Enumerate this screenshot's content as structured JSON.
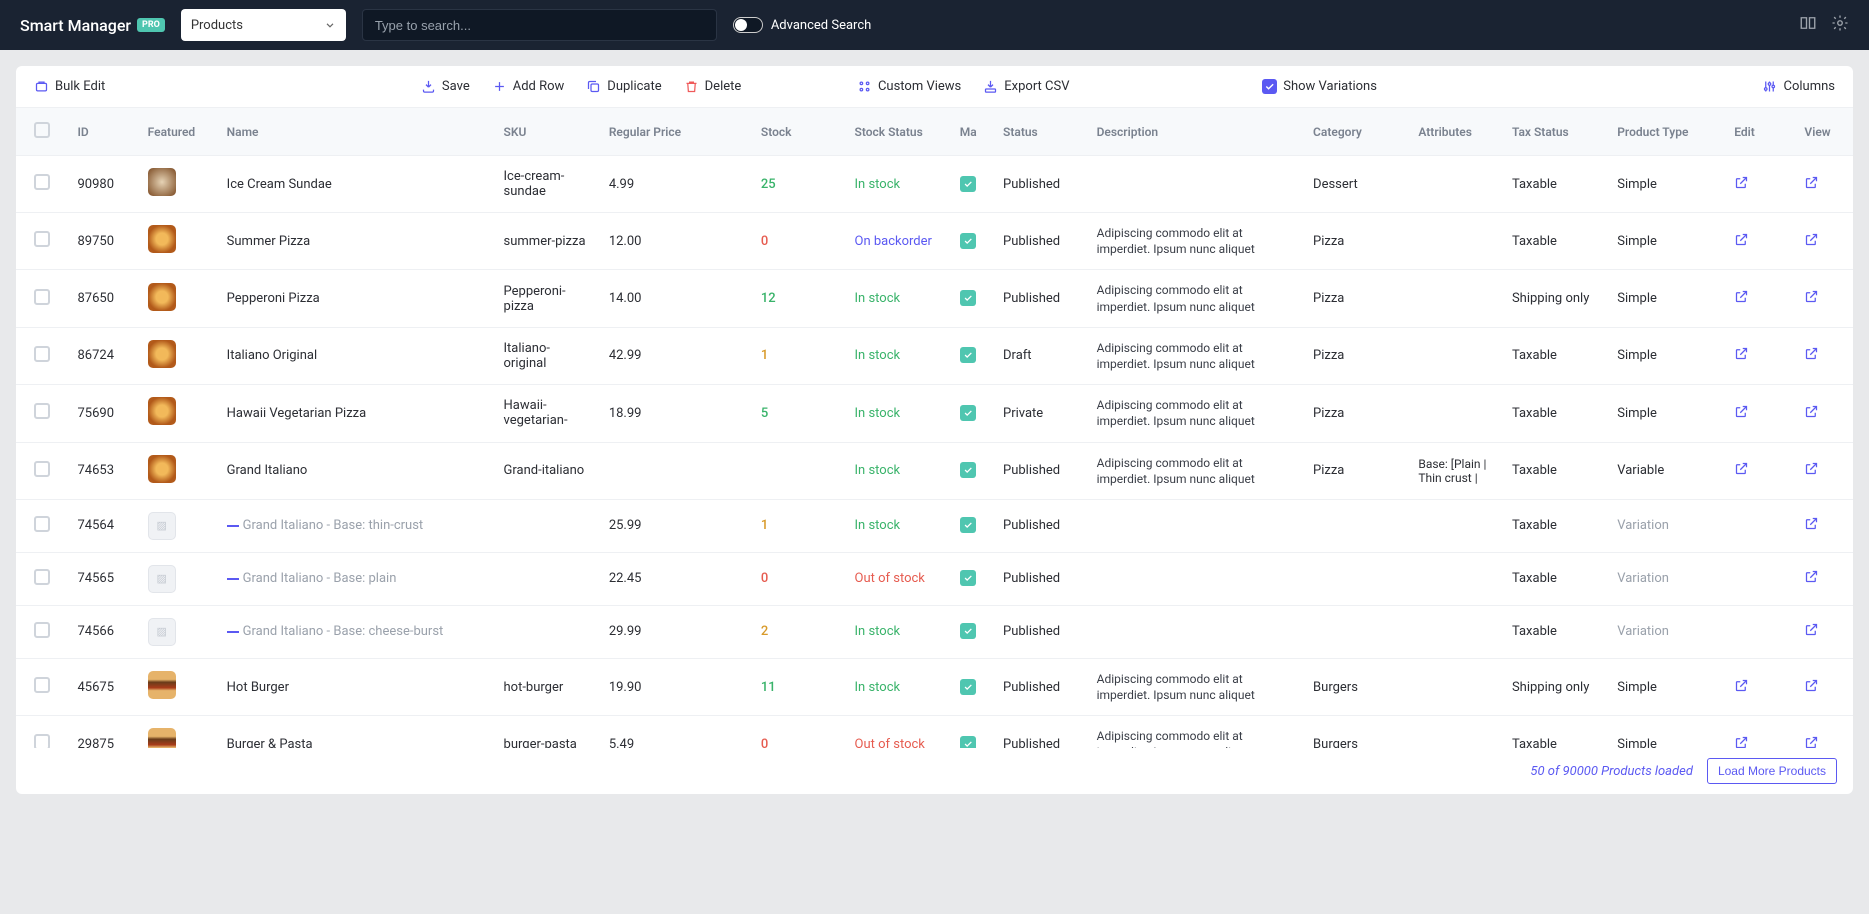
{
  "brand": {
    "name": "Smart Manager",
    "badge": "PRO"
  },
  "post_type_select": "Products",
  "search": {
    "placeholder": "Type to search..."
  },
  "advanced_search_label": "Advanced Search",
  "toolbar": {
    "bulk_edit": "Bulk Edit",
    "save": "Save",
    "add_row": "Add Row",
    "duplicate": "Duplicate",
    "delete": "Delete",
    "custom_views": "Custom Views",
    "export_csv": "Export CSV",
    "show_variations": "Show Variations",
    "columns": "Columns"
  },
  "columns": [
    "",
    "ID",
    "Featured",
    "Name",
    "SKU",
    "Regular Price",
    "Stock",
    "Stock Status",
    "Ma",
    "Status",
    "Description",
    "Category",
    "Attributes",
    "Tax Status",
    "Product Type",
    "Edit",
    "View"
  ],
  "rows": [
    {
      "id": "90980",
      "thumb": "dessert",
      "name": "Ice Cream Sundae",
      "sku": "Ice-cream-sundae",
      "price": "4.99",
      "stock": "25",
      "stock_cls": "green",
      "stock_status": "In stock",
      "ss_cls": "green",
      "status": "Published",
      "desc": "",
      "cat": "Dessert",
      "attr": "",
      "tax": "Taxable",
      "ptype": "Simple",
      "ptype_muted": false,
      "edit": true
    },
    {
      "id": "89750",
      "thumb": "pizza",
      "name": "Summer Pizza",
      "sku": "summer-pizza",
      "price": "12.00",
      "stock": "0",
      "stock_cls": "red",
      "stock_status": "On backorder",
      "ss_cls": "blue",
      "status": "Published",
      "desc": "Adipiscing commodo elit at imperdiet. Ipsum nunc aliquet",
      "cat": "Pizza",
      "attr": "",
      "tax": "Taxable",
      "ptype": "Simple",
      "ptype_muted": false,
      "edit": true
    },
    {
      "id": "87650",
      "thumb": "pizza",
      "name": "Pepperoni Pizza",
      "sku": "Pepperoni-pizza",
      "price": "14.00",
      "stock": "12",
      "stock_cls": "green",
      "stock_status": "In stock",
      "ss_cls": "green",
      "status": "Published",
      "desc": "Adipiscing commodo elit at imperdiet. Ipsum nunc aliquet",
      "cat": "Pizza",
      "attr": "",
      "tax": "Shipping only",
      "ptype": "Simple",
      "ptype_muted": false,
      "edit": true
    },
    {
      "id": "86724",
      "thumb": "pizza",
      "name": "Italiano Original",
      "sku": "Italiano-original",
      "price": "42.99",
      "stock": "1",
      "stock_cls": "orange",
      "stock_status": "In stock",
      "ss_cls": "green",
      "status": "Draft",
      "desc": "Adipiscing commodo elit at imperdiet. Ipsum nunc aliquet",
      "cat": "Pizza",
      "attr": "",
      "tax": "Taxable",
      "ptype": "Simple",
      "ptype_muted": false,
      "edit": true
    },
    {
      "id": "75690",
      "thumb": "pizza",
      "name": "Hawaii Vegetarian Pizza",
      "sku": "Hawaii-vegetarian-",
      "price": "18.99",
      "stock": "5",
      "stock_cls": "green",
      "stock_status": "In stock",
      "ss_cls": "green",
      "status": "Private",
      "desc": "Adipiscing commodo elit at imperdiet. Ipsum nunc aliquet",
      "cat": "Pizza",
      "attr": "",
      "tax": "Taxable",
      "ptype": "Simple",
      "ptype_muted": false,
      "edit": true
    },
    {
      "id": "74653",
      "thumb": "pizza",
      "name": "Grand Italiano",
      "sku": "Grand-italiano",
      "price": "",
      "stock": "",
      "stock_cls": "",
      "stock_status": "In stock",
      "ss_cls": "green",
      "status": "Published",
      "desc": "Adipiscing commodo elit at imperdiet. Ipsum nunc aliquet",
      "cat": "Pizza",
      "attr": "Base: [Plain | Thin crust |",
      "tax": "Taxable",
      "ptype": "Variable",
      "ptype_muted": false,
      "edit": true
    },
    {
      "id": "74564",
      "thumb": "placeholder",
      "variation": true,
      "name": "Grand Italiano - Base: thin-crust",
      "sku": "",
      "price": "25.99",
      "stock": "1",
      "stock_cls": "orange",
      "stock_status": "In stock",
      "ss_cls": "green",
      "status": "Published",
      "desc": "",
      "cat": "",
      "attr": "",
      "tax": "Taxable",
      "ptype": "Variation",
      "ptype_muted": true,
      "edit": false
    },
    {
      "id": "74565",
      "thumb": "placeholder",
      "variation": true,
      "name": "Grand Italiano - Base: plain",
      "sku": "",
      "price": "22.45",
      "stock": "0",
      "stock_cls": "red",
      "stock_status": "Out of stock",
      "ss_cls": "red",
      "status": "Published",
      "desc": "",
      "cat": "",
      "attr": "",
      "tax": "Taxable",
      "ptype": "Variation",
      "ptype_muted": true,
      "edit": false
    },
    {
      "id": "74566",
      "thumb": "placeholder",
      "variation": true,
      "name": "Grand Italiano - Base: cheese-burst",
      "sku": "",
      "price": "29.99",
      "stock": "2",
      "stock_cls": "orange",
      "stock_status": "In stock",
      "ss_cls": "green",
      "status": "Published",
      "desc": "",
      "cat": "",
      "attr": "",
      "tax": "Taxable",
      "ptype": "Variation",
      "ptype_muted": true,
      "edit": false
    },
    {
      "id": "45675",
      "thumb": "burger",
      "name": "Hot Burger",
      "sku": "hot-burger",
      "price": "19.90",
      "stock": "11",
      "stock_cls": "green",
      "stock_status": "In stock",
      "ss_cls": "green",
      "status": "Published",
      "desc": "Adipiscing commodo elit at imperdiet. Ipsum nunc aliquet",
      "cat": "Burgers",
      "attr": "",
      "tax": "Shipping only",
      "ptype": "Simple",
      "ptype_muted": false,
      "edit": true
    },
    {
      "id": "29875",
      "thumb": "burger",
      "name": "Burger & Pasta",
      "sku": "burger-pasta",
      "price": "5.49",
      "stock": "0",
      "stock_cls": "red",
      "stock_status": "Out of stock",
      "ss_cls": "red",
      "status": "Published",
      "desc": "Adipiscing commodo elit at imperdiet. Ipsum nunc aliquet",
      "cat": "Burgers",
      "attr": "",
      "tax": "Taxable",
      "ptype": "Simple",
      "ptype_muted": false,
      "edit": true
    }
  ],
  "footer": {
    "count": "50 of 90000 Products loaded",
    "button": "Load More Products"
  }
}
